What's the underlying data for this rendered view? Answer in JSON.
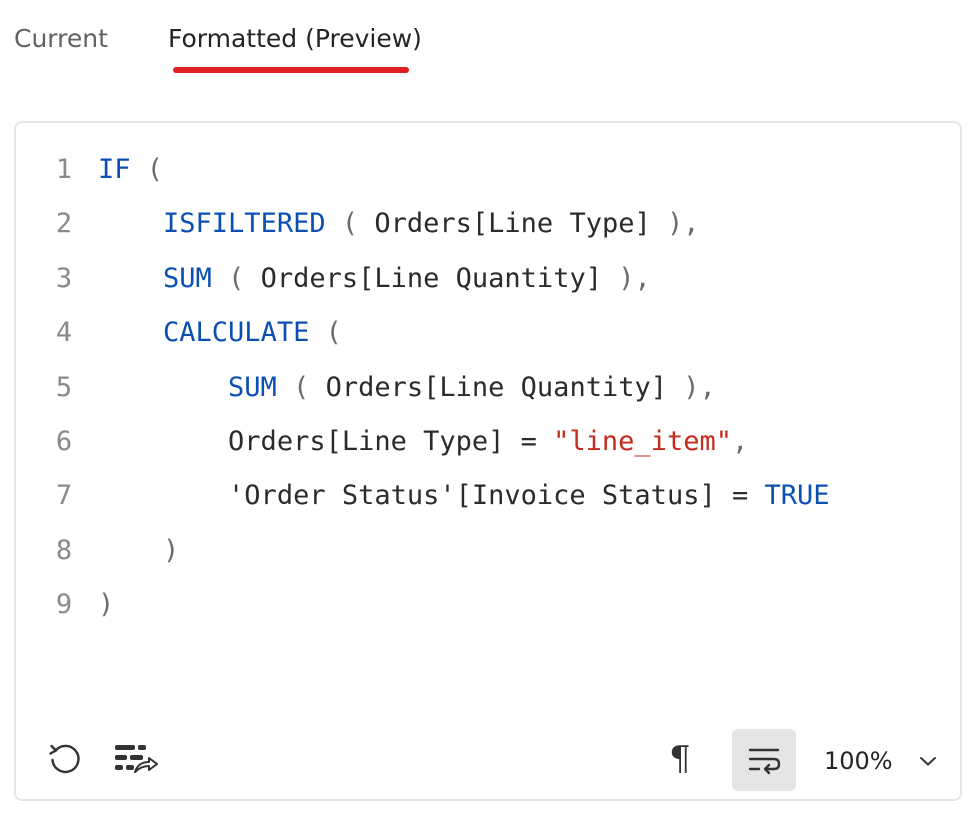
{
  "tabs": {
    "current_label": "Current",
    "formatted_label": "Formatted (Preview)",
    "active": "formatted"
  },
  "colors": {
    "tab_underline": "#e02020",
    "keyword": "#0b4fb3",
    "string": "#c42b1c",
    "line_number": "#8a8a8a",
    "wrap_button_bg": "#e5e5e5"
  },
  "editor": {
    "lines": [
      {
        "number": "1",
        "tokens": [
          {
            "text": "IF",
            "kind": "kw"
          },
          {
            "text": " (",
            "kind": "pun"
          }
        ]
      },
      {
        "number": "2",
        "tokens": [
          {
            "text": "    ",
            "kind": "plain"
          },
          {
            "text": "ISFILTERED",
            "kind": "kw"
          },
          {
            "text": " ( ",
            "kind": "pun"
          },
          {
            "text": "Orders[Line Type]",
            "kind": "plain"
          },
          {
            "text": " ),",
            "kind": "pun"
          }
        ]
      },
      {
        "number": "3",
        "tokens": [
          {
            "text": "    ",
            "kind": "plain"
          },
          {
            "text": "SUM",
            "kind": "kw"
          },
          {
            "text": " ( ",
            "kind": "pun"
          },
          {
            "text": "Orders[Line Quantity]",
            "kind": "plain"
          },
          {
            "text": " ),",
            "kind": "pun"
          }
        ]
      },
      {
        "number": "4",
        "tokens": [
          {
            "text": "    ",
            "kind": "plain"
          },
          {
            "text": "CALCULATE",
            "kind": "kw"
          },
          {
            "text": " (",
            "kind": "pun"
          }
        ]
      },
      {
        "number": "5",
        "tokens": [
          {
            "text": "        ",
            "kind": "plain"
          },
          {
            "text": "SUM",
            "kind": "kw"
          },
          {
            "text": " ( ",
            "kind": "pun"
          },
          {
            "text": "Orders[Line Quantity]",
            "kind": "plain"
          },
          {
            "text": " ),",
            "kind": "pun"
          }
        ]
      },
      {
        "number": "6",
        "tokens": [
          {
            "text": "        ",
            "kind": "plain"
          },
          {
            "text": "Orders[Line Type] = ",
            "kind": "plain"
          },
          {
            "text": "\"line_item\"",
            "kind": "str"
          },
          {
            "text": ",",
            "kind": "pun"
          }
        ]
      },
      {
        "number": "7",
        "tokens": [
          {
            "text": "        ",
            "kind": "plain"
          },
          {
            "text": "'Order Status'[Invoice Status] = ",
            "kind": "plain"
          },
          {
            "text": "TRUE",
            "kind": "kw"
          }
        ]
      },
      {
        "number": "8",
        "tokens": [
          {
            "text": "    ",
            "kind": "plain"
          },
          {
            "text": ")",
            "kind": "pun"
          }
        ]
      },
      {
        "number": "9",
        "tokens": [
          {
            "text": ")",
            "kind": "pun"
          }
        ]
      }
    ]
  },
  "toolbar": {
    "reset_icon": "reset-icon",
    "format_icon": "format-code-icon",
    "pilcrow_glyph": "¶",
    "wrap_icon": "word-wrap-icon",
    "wrap_active": true,
    "zoom_value": "100%",
    "zoom_chevron_icon": "chevron-down-icon"
  }
}
